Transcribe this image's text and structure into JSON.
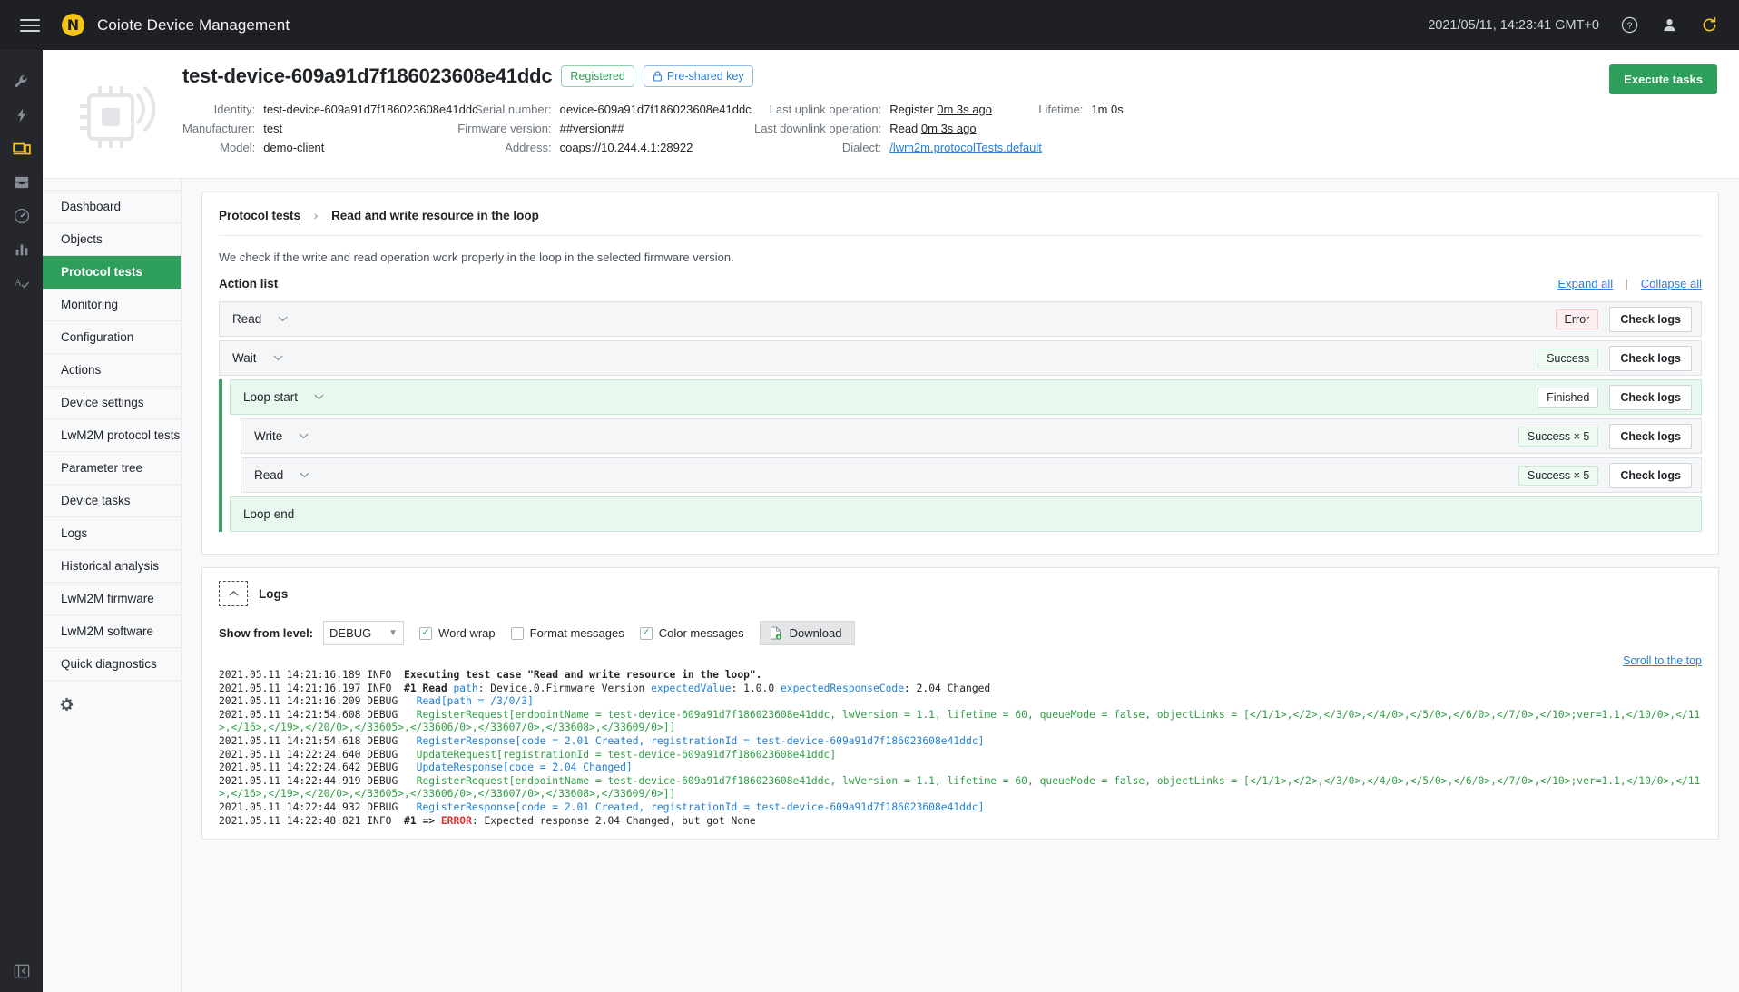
{
  "topbar": {
    "menu_icon": "hamburger-icon",
    "logo_glyph": "N",
    "title": "Coiote Device Management",
    "clock": "2021/05/11, 14:23:41 GMT+0",
    "help_icon": "help-circle-icon",
    "account_icon": "user-icon",
    "refresh_icon": "refresh-icon"
  },
  "rail": {
    "items": [
      {
        "name": "wrench-icon",
        "active": false
      },
      {
        "name": "bolt-icon",
        "active": false
      },
      {
        "name": "device-monitor-icon",
        "active": true
      },
      {
        "name": "inbox-icon",
        "active": false
      },
      {
        "name": "gauge-icon",
        "active": false
      },
      {
        "name": "bar-chart-icon",
        "active": false
      },
      {
        "name": "spellcheck-icon",
        "active": false
      }
    ],
    "collapse_icon": "collapse-panel-icon"
  },
  "device": {
    "title": "test-device-609a91d7f186023608e41ddc",
    "status_chip": "Registered",
    "security_chip": "Pre-shared key",
    "execute_tasks": "Execute tasks",
    "fields": {
      "identity_label": "Identity:",
      "identity_value": "test-device-609a91d7f186023608e41ddc",
      "manufacturer_label": "Manufacturer:",
      "manufacturer_value": "test",
      "model_label": "Model:",
      "model_value": "demo-client",
      "serial_label": "Serial number:",
      "serial_value": "device-609a91d7f186023608e41ddc",
      "firmware_label": "Firmware version:",
      "firmware_value": "##version##",
      "address_label": "Address:",
      "address_value": "coaps://10.244.4.1:28922",
      "uplink_label": "Last uplink operation:",
      "uplink_op": "Register",
      "uplink_time": "0m 3s ago",
      "downlink_label": "Last downlink operation:",
      "downlink_op": "Read",
      "downlink_time": "0m 3s ago",
      "lifetime_label": "Lifetime:",
      "lifetime_value": "1m 0s",
      "dialect_label": "Dialect:",
      "dialect_value": "/lwm2m.protocolTests.default"
    }
  },
  "leftnav": {
    "items": [
      {
        "label": "Dashboard",
        "active": false
      },
      {
        "label": "Objects",
        "active": false
      },
      {
        "label": "Protocol tests",
        "active": true
      },
      {
        "label": "Monitoring",
        "active": false
      },
      {
        "label": "Configuration",
        "active": false
      },
      {
        "label": "Actions",
        "active": false
      },
      {
        "label": "Device settings",
        "active": false
      },
      {
        "label": "LwM2M protocol tests",
        "active": false
      },
      {
        "label": "Parameter tree",
        "active": false
      },
      {
        "label": "Device tasks",
        "active": false
      },
      {
        "label": "Logs",
        "active": false
      },
      {
        "label": "Historical analysis",
        "active": false
      },
      {
        "label": "LwM2M firmware",
        "active": false
      },
      {
        "label": "LwM2M software",
        "active": false
      },
      {
        "label": "Quick diagnostics",
        "active": false
      }
    ],
    "settings_icon": "gear-icon"
  },
  "test": {
    "breadcrumb_root": "Protocol tests",
    "breadcrumb_sep": "›",
    "breadcrumb_current": "Read and write resource in the loop",
    "description": "We check if the write and read operation work properly in the loop in the selected firmware version.",
    "action_list_label": "Action list",
    "expand_all": "Expand all",
    "collapse_all": "Collapse all",
    "check_logs_label": "Check logs",
    "actions": [
      {
        "label": "Read",
        "badge": "Error",
        "badge_type": "error",
        "highlight": false,
        "nested": false,
        "has_chevron": true,
        "has_badge": true
      },
      {
        "label": "Wait",
        "badge": "Success",
        "badge_type": "success",
        "highlight": false,
        "nested": false,
        "has_chevron": true,
        "has_badge": true
      },
      {
        "label": "Loop start",
        "badge": "Finished",
        "badge_type": "finished",
        "highlight": true,
        "nested": false,
        "has_chevron": true,
        "has_badge": true
      },
      {
        "label": "Write",
        "badge": "Success × 5",
        "badge_type": "success",
        "highlight": false,
        "nested": true,
        "has_chevron": true,
        "has_badge": true
      },
      {
        "label": "Read",
        "badge": "Success × 5",
        "badge_type": "success",
        "highlight": false,
        "nested": true,
        "has_chevron": true,
        "has_badge": true
      },
      {
        "label": "Loop end",
        "badge": "",
        "badge_type": "",
        "highlight": true,
        "nested": false,
        "has_chevron": false,
        "has_badge": false
      }
    ]
  },
  "logs": {
    "title": "Logs",
    "collapse_icon": "chevron-up-icon",
    "level_label": "Show from level:",
    "level_value": "DEBUG",
    "word_wrap_label": "Word wrap",
    "word_wrap_checked": true,
    "format_messages_label": "Format messages",
    "format_messages_checked": false,
    "color_messages_label": "Color messages",
    "color_messages_checked": true,
    "download_label": "Download",
    "download_icon": "download-file-icon",
    "scroll_to_top": "Scroll to the top",
    "lines": [
      {
        "ts": "2021.05.11 14:21:16.189",
        "level": "INFO ",
        "segments": [
          {
            "t": " Executing test case \"Read and write resource in the loop\".",
            "c": "plain",
            "b": true
          }
        ]
      },
      {
        "ts": "2021.05.11 14:21:16.197",
        "level": "INFO ",
        "segments": [
          {
            "t": " #1 Read ",
            "c": "plain",
            "b": true
          },
          {
            "t": "path",
            "c": "blue",
            "b": false
          },
          {
            "t": ": Device.0.Firmware Version ",
            "c": "plain",
            "b": false
          },
          {
            "t": "expectedValue",
            "c": "blue",
            "b": false
          },
          {
            "t": ": 1.0.0 ",
            "c": "plain",
            "b": false
          },
          {
            "t": "expectedResponseCode",
            "c": "blue",
            "b": false
          },
          {
            "t": ": 2.04 Changed",
            "c": "plain",
            "b": false
          }
        ]
      },
      {
        "ts": "2021.05.11 14:21:16.209",
        "level": "DEBUG",
        "segments": [
          {
            "t": "   Read[path = /3/0/3]",
            "c": "blue",
            "b": false
          }
        ]
      },
      {
        "ts": "2021.05.11 14:21:54.608",
        "level": "DEBUG",
        "segments": [
          {
            "t": "   RegisterRequest[endpointName = test-device-609a91d7f186023608e41ddc, lwVersion = 1.1, lifetime = 60, queueMode = false, objectLinks = [</1/1>,</2>,</3/0>,</4/0>,</5/0>,</6/0>,</7/0>,</10>;ver=1.1,</10/0>,</11>,</16>,</19>,</20/0>,</33605>,</33606/0>,</33607/0>,</33608>,</33609/0>]]",
            "c": "green",
            "b": false
          }
        ]
      },
      {
        "ts": "2021.05.11 14:21:54.618",
        "level": "DEBUG",
        "segments": [
          {
            "t": "   RegisterResponse[code = 2.01 Created, registrationId = test-device-609a91d7f186023608e41ddc]",
            "c": "blue",
            "b": false
          }
        ]
      },
      {
        "ts": "2021.05.11 14:22:24.640",
        "level": "DEBUG",
        "segments": [
          {
            "t": "   UpdateRequest[registrationId = test-device-609a91d7f186023608e41ddc]",
            "c": "green",
            "b": false
          }
        ]
      },
      {
        "ts": "2021.05.11 14:22:24.642",
        "level": "DEBUG",
        "segments": [
          {
            "t": "   UpdateResponse[code = 2.04 Changed]",
            "c": "blue",
            "b": false
          }
        ]
      },
      {
        "ts": "2021.05.11 14:22:44.919",
        "level": "DEBUG",
        "segments": [
          {
            "t": "   RegisterRequest[endpointName = test-device-609a91d7f186023608e41ddc, lwVersion = 1.1, lifetime = 60, queueMode = false, objectLinks = [</1/1>,</2>,</3/0>,</4/0>,</5/0>,</6/0>,</7/0>,</10>;ver=1.1,</10/0>,</11>,</16>,</19>,</20/0>,</33605>,</33606/0>,</33607/0>,</33608>,</33609/0>]]",
            "c": "green",
            "b": false
          }
        ]
      },
      {
        "ts": "2021.05.11 14:22:44.932",
        "level": "DEBUG",
        "segments": [
          {
            "t": "   RegisterResponse[code = 2.01 Created, registrationId = test-device-609a91d7f186023608e41ddc]",
            "c": "blue",
            "b": false
          }
        ]
      },
      {
        "ts": "2021.05.11 14:22:48.821",
        "level": "INFO ",
        "segments": [
          {
            "t": " #1 => ",
            "c": "plain",
            "b": true
          },
          {
            "t": "ERROR",
            "c": "red",
            "b": true
          },
          {
            "t": ": Expected response 2.04 Changed, but got None",
            "c": "plain",
            "b": false
          }
        ]
      }
    ]
  },
  "colors": {
    "accent_green": "#2e9e5b",
    "brand_yellow": "#f5c518",
    "link_blue": "#2a7fd4",
    "topbar_bg": "#1e2024",
    "rail_bg": "#25272c"
  }
}
